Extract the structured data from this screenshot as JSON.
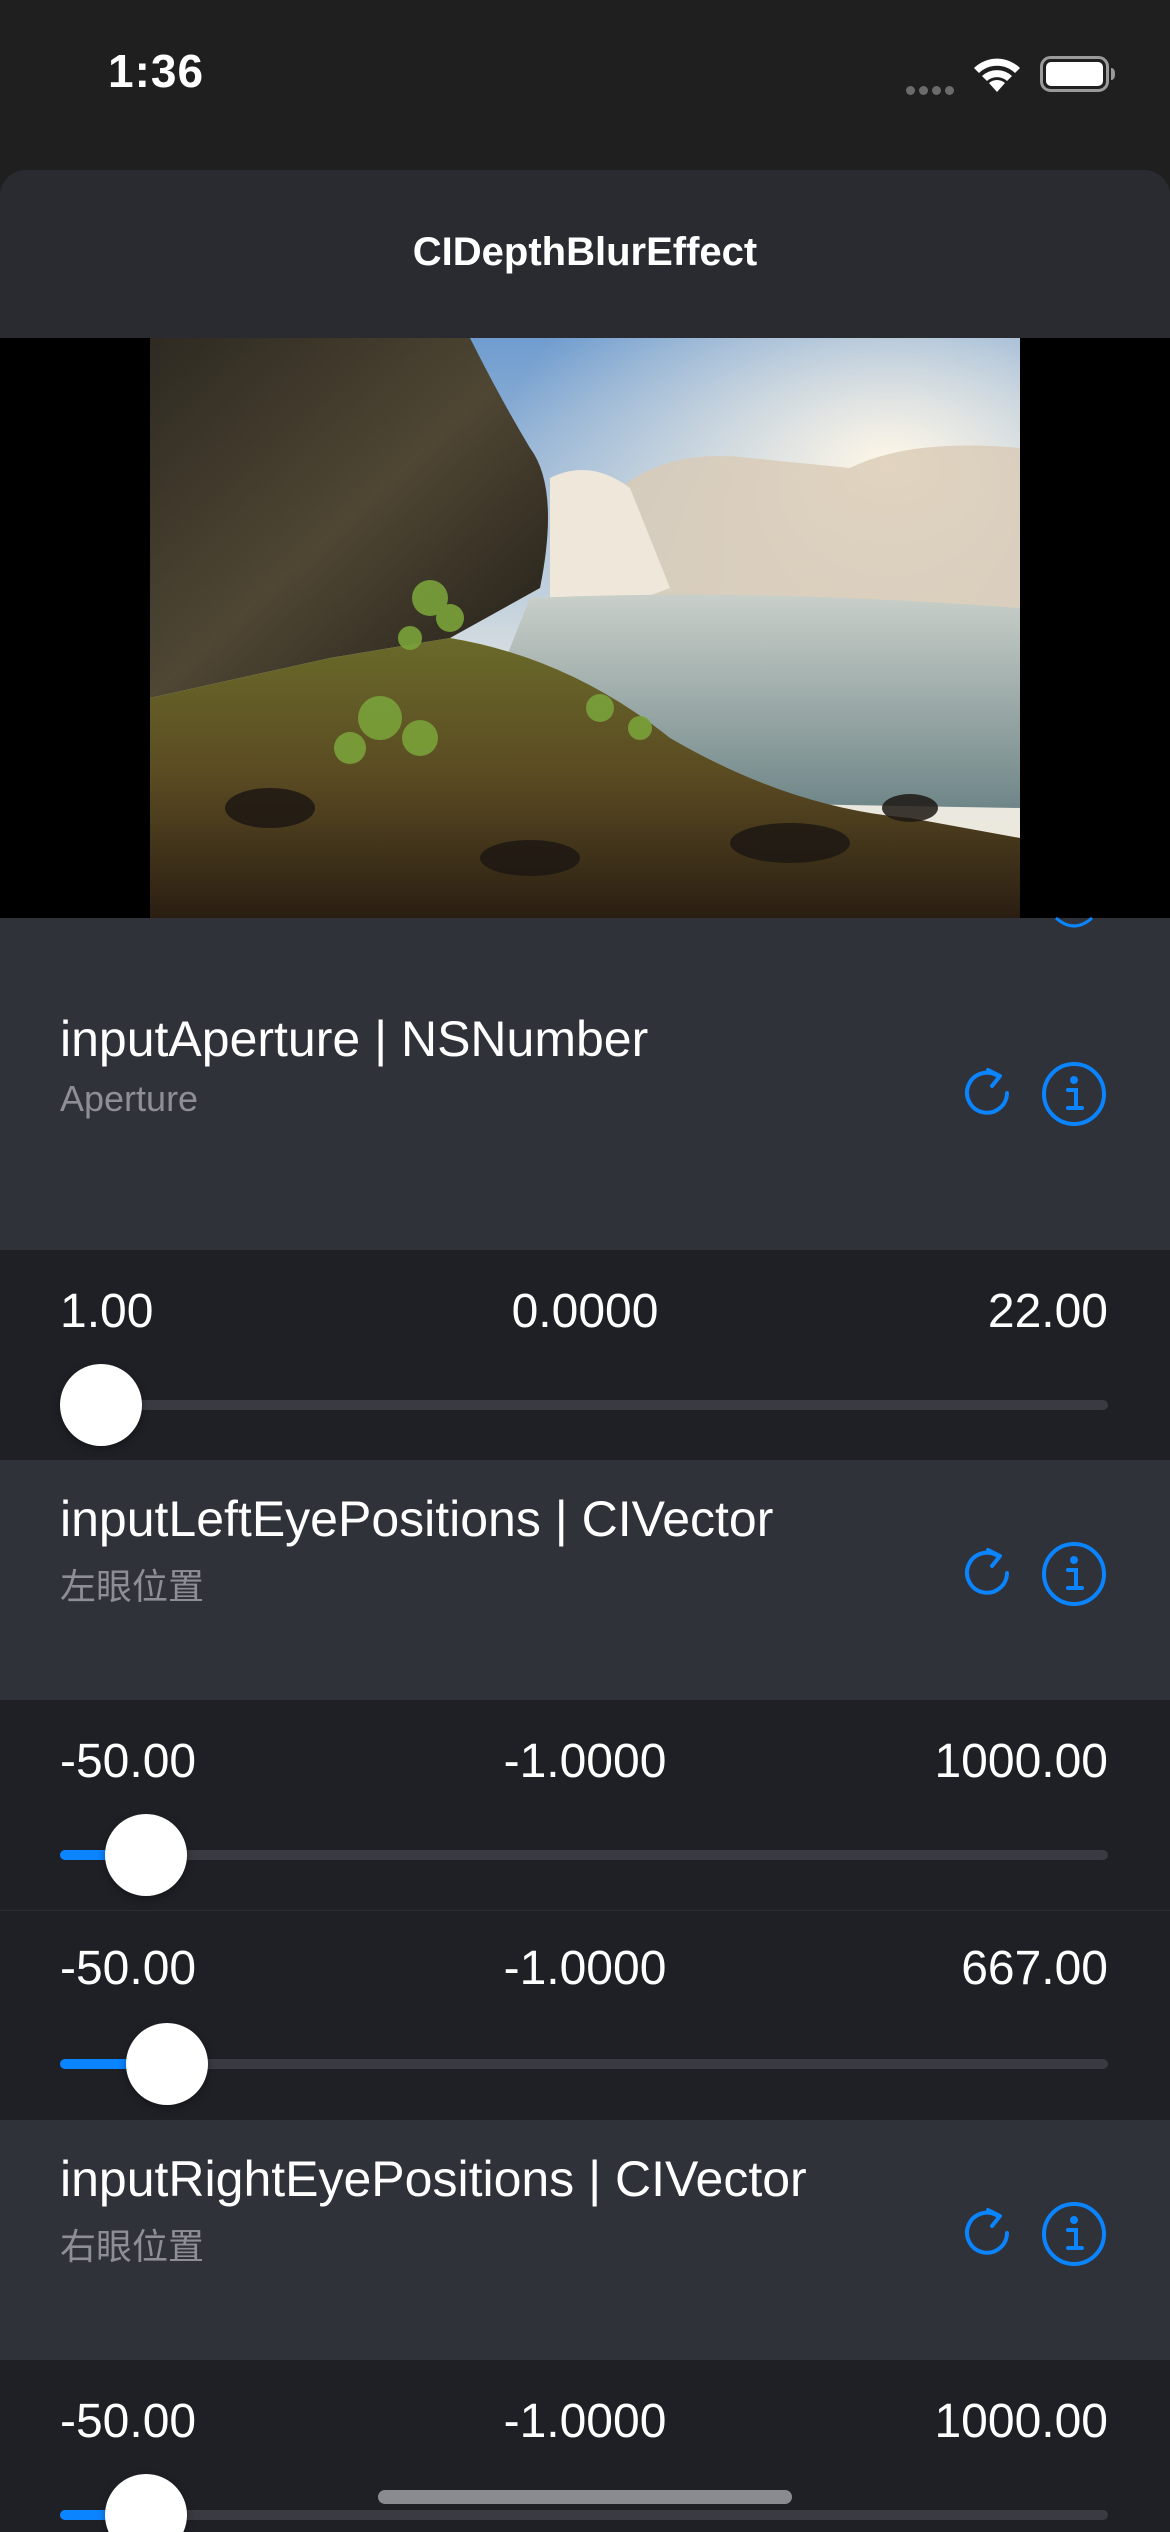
{
  "status_bar": {
    "time": "1:36"
  },
  "nav": {
    "title": "CIDepthBlurEffect"
  },
  "params": [
    {
      "title": "inputAperture | NSNumber",
      "subtitle": "Aperture"
    },
    {
      "title": "inputLeftEyePositions | CIVector",
      "subtitle": "左眼位置"
    },
    {
      "title": "inputRightEyePositions | CIVector",
      "subtitle": "右眼位置"
    }
  ],
  "sliders": [
    {
      "min": "1.00",
      "current": "0.0000",
      "max": "22.00",
      "fraction": 0.0
    },
    {
      "min": "-50.00",
      "current": "-1.0000",
      "max": "1000.00",
      "fraction": 0.047
    },
    {
      "min": "-50.00",
      "current": "-1.0000",
      "max": "667.00",
      "fraction": 0.068
    },
    {
      "min": "-50.00",
      "current": "-1.0000",
      "max": "1000.00",
      "fraction": 0.047
    }
  ],
  "colors": {
    "accent": "#0a84ff",
    "sheet": "#30323a",
    "row": "#1f2026",
    "subtitle": "#8e8f96"
  },
  "icons": [
    "wifi-icon",
    "battery-icon",
    "reset-icon",
    "info-icon"
  ]
}
